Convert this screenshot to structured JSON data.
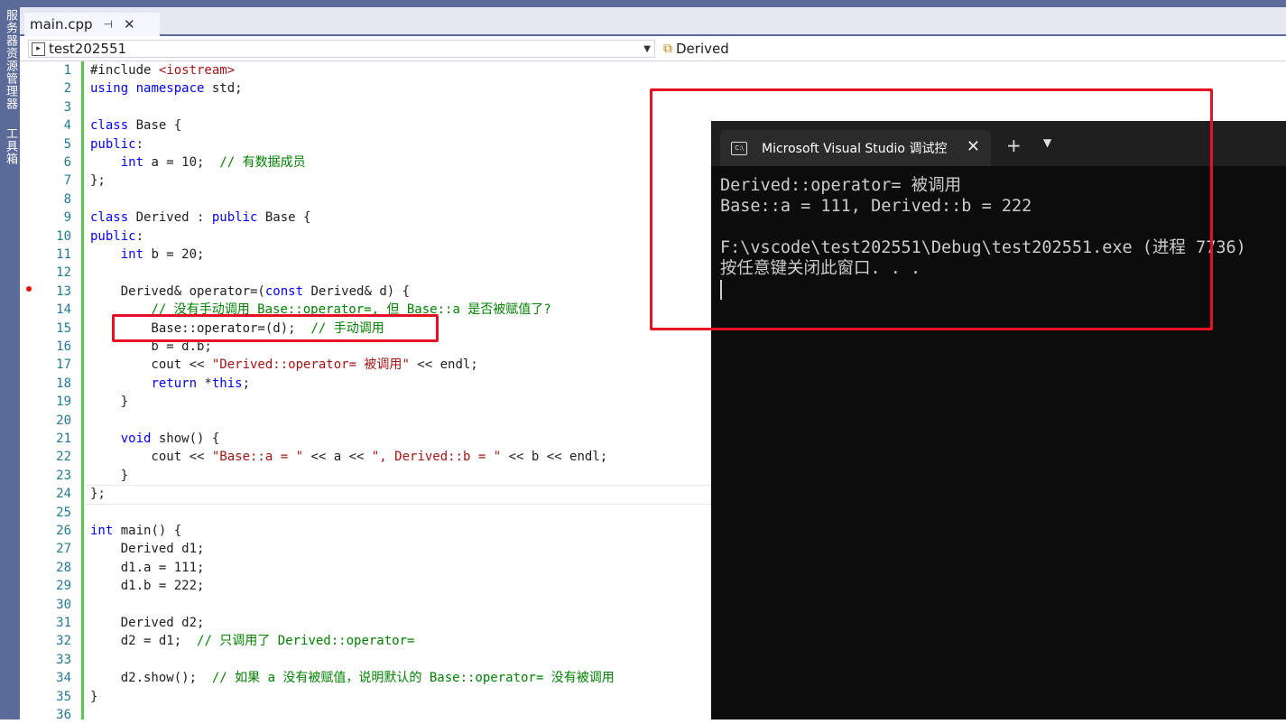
{
  "side_panel": {
    "label_1": "服务器资源管理器",
    "label_2": "工具箱"
  },
  "tab": {
    "title": "main.cpp",
    "pin_glyph": "⊣",
    "close_glyph": "✕"
  },
  "nav": {
    "project": "test202551",
    "scope": "Derived"
  },
  "code_lines": [
    "#include <iostream>",
    "using namespace std;",
    "",
    "class Base {",
    "public:",
    "    int a = 10;  // 有数据成员",
    "};",
    "",
    "class Derived : public Base {",
    "public:",
    "    int b = 20;",
    "",
    "    Derived& operator=(const Derived& d) {",
    "        // 没有手动调用 Base::operator=, 但 Base::a 是否被赋值了?",
    "        Base::operator=(d);  // 手动调用",
    "        b = d.b;",
    "        cout << \"Derived::operator= 被调用\" << endl;",
    "        return *this;",
    "    }",
    "",
    "    void show() {",
    "        cout << \"Base::a = \" << a << \", Derived::b = \" << b << endl;",
    "    }",
    "};",
    "",
    "int main() {",
    "    Derived d1;",
    "    d1.a = 111;",
    "    d1.b = 222;",
    "",
    "    Derived d2;",
    "    d2 = d1;  // 只调用了 Derived::operator=",
    "",
    "    d2.show();  // 如果 a 没有被赋值，说明默认的 Base::operator= 没有被调用",
    "}",
    ""
  ],
  "terminal": {
    "tab_title": "Microsoft Visual Studio 调试控",
    "icon_text": "C:\\",
    "plus": "+",
    "chevron": "⌄",
    "close": "✕",
    "output_1": "Derived::operator= 被调用",
    "output_2": "Base::a = 111, Derived::b = 222",
    "output_3": "",
    "output_4": "F:\\vscode\\test202551\\Debug\\test202551.exe (进程 7736)",
    "output_5": "按任意键关闭此窗口. . ."
  },
  "colors": {
    "accent": "#5a6a99",
    "highlight": "#e81123",
    "keyword": "#0000ff",
    "comment": "#008000",
    "string": "#a31515"
  }
}
